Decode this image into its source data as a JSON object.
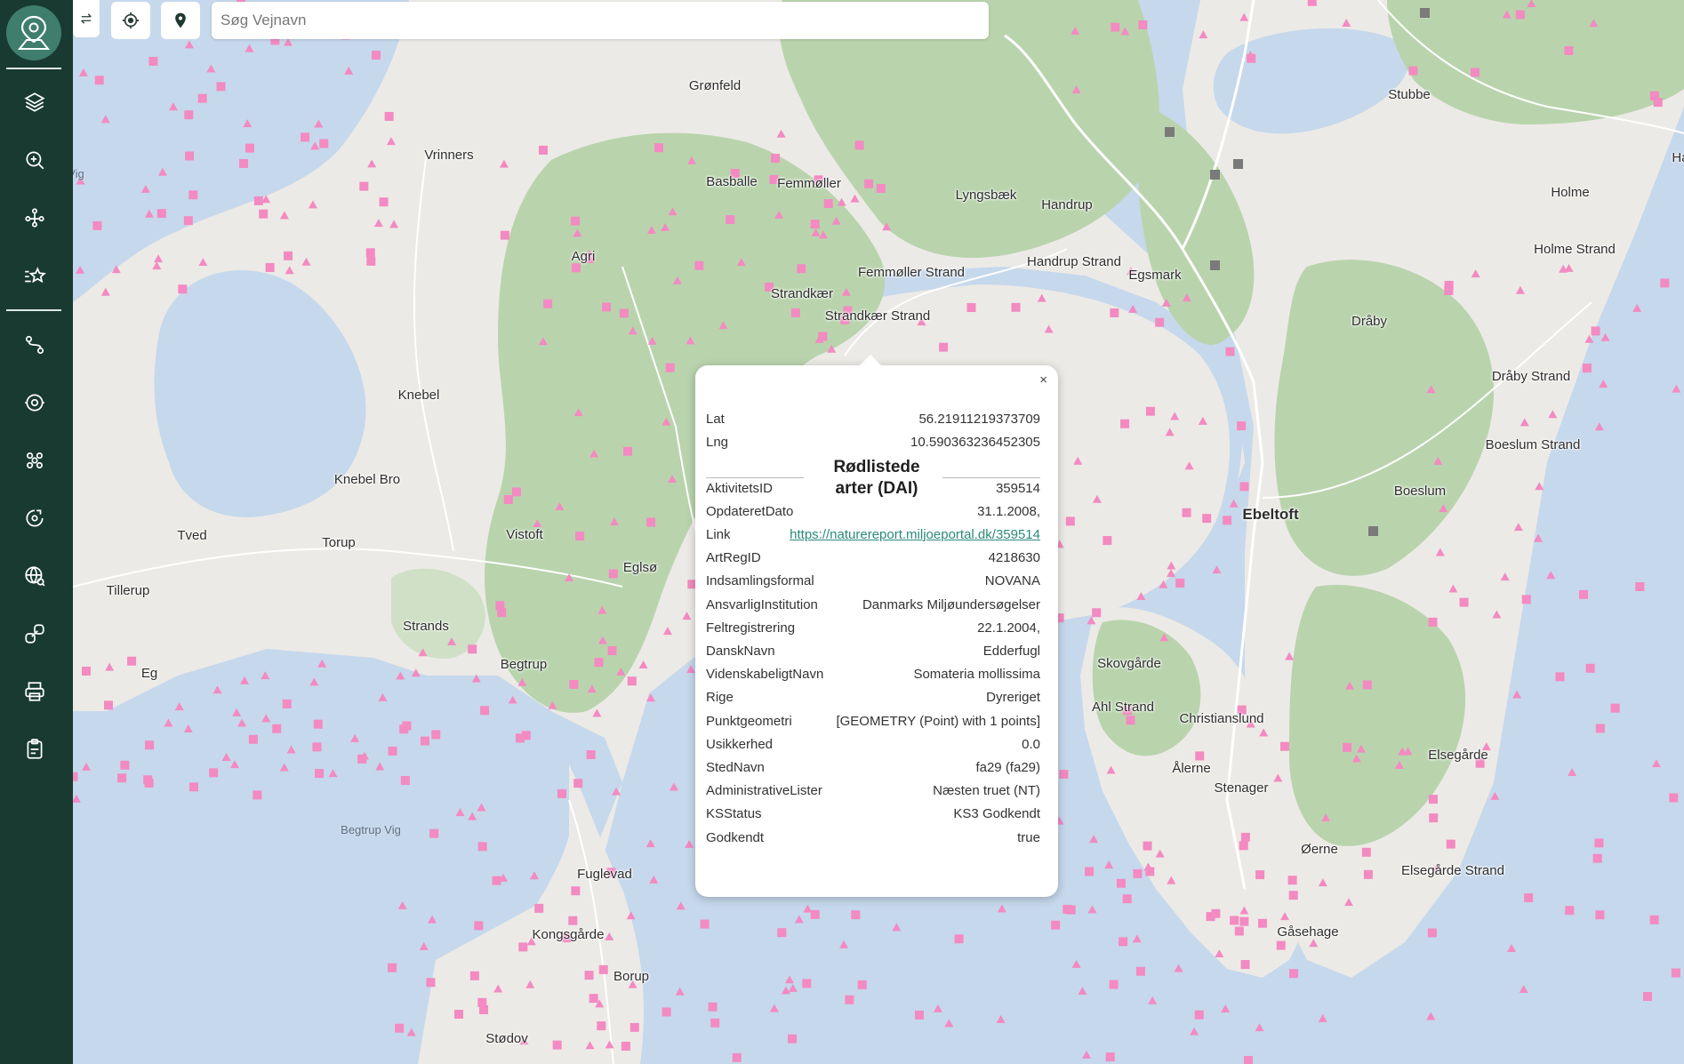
{
  "search": {
    "placeholder": "Søg Vejnavn"
  },
  "icons": {
    "logo": "map-pin-logo-icon",
    "collapse": "swap-arrows-icon",
    "locate": "crosshair-icon",
    "pin": "location-pin-icon",
    "sidebar": [
      "layers-icon",
      "zoom-plus-icon",
      "network-nodes-icon",
      "star-list-icon",
      "route-icon",
      "target-cycle-icon",
      "cluster-icon",
      "location-refresh-icon",
      "globe-search-icon",
      "link-icon",
      "print-icon",
      "clipboard-icon"
    ]
  },
  "colors": {
    "sidebar": "#183a31",
    "logo": "#3f7d6c",
    "water": "#c6d8ec",
    "land": "#eceae6",
    "forest": "#b9d4ad",
    "marker": "#f38ac2",
    "link": "#2a8a78"
  },
  "places": [
    "Grønfeld",
    "Stubbe",
    "Vrinners",
    "Basballe",
    "Femmøller",
    "Lyngsbæk",
    "Handrup",
    "Holme",
    "Agri",
    "Femmøller Strand",
    "Handrup Strand",
    "Egsmark",
    "Holme Strand",
    "Strandkær",
    "Strandkær Strand",
    "Dråby",
    "Knebel",
    "Dråby Strand",
    "Boeslum Strand",
    "Knebel Bro",
    "Boeslum",
    "Ebeltoft",
    "Tved",
    "Torup",
    "Vistoft",
    "Eglsø",
    "Tillerup",
    "Strands",
    "Skovgårde",
    "Eg",
    "Begtrup",
    "Ahl Strand",
    "Christianslund",
    "Elsegårde",
    "Ålerne",
    "Stenager",
    "Begtrup Vig",
    "Øerne",
    "Fuglevad",
    "Elsegårde Strand",
    "Kongsgårde",
    "Gåsehage",
    "Borup",
    "Stødov",
    "o Vig",
    "Ha"
  ],
  "popup": {
    "lat_label": "Lat",
    "lat_value": "56.21911219373709",
    "lng_label": "Lng",
    "lng_value": "10.590363236452305",
    "title": "Rødlistede arter (DAI)",
    "close": "×",
    "rows": [
      {
        "key": "AktivitetsID",
        "value": "359514"
      },
      {
        "key": "OpdateretDato",
        "value": "31.1.2008,"
      },
      {
        "key": "Link",
        "value": "https://naturereport.miljoeportal.dk/359514"
      },
      {
        "key": "ArtRegID",
        "value": "4218630"
      },
      {
        "key": "Indsamlingsformal",
        "value": "NOVANA"
      },
      {
        "key": "AnsvarligInstitution",
        "value": "Danmarks Miljøundersøgelser"
      },
      {
        "key": "Feltregistrering",
        "value": "22.1.2004,"
      },
      {
        "key": "DanskNavn",
        "value": "Edderfugl"
      },
      {
        "key": "VidenskabeligtNavn",
        "value": "Somateria mollissima"
      },
      {
        "key": "Rige",
        "value": "Dyreriget"
      },
      {
        "key": "Punktgeometri",
        "value": "[GEOMETRY (Point) with 1 points]"
      },
      {
        "key": "Usikkerhed",
        "value": "0.0"
      },
      {
        "key": "StedNavn",
        "value": "fa29 (fa29)"
      },
      {
        "key": "AdministrativeLister",
        "value": "Næsten truet (NT)"
      },
      {
        "key": "KSStatus",
        "value": "KS3 Godkendt"
      },
      {
        "key": "Godkendt",
        "value": "true"
      }
    ]
  }
}
